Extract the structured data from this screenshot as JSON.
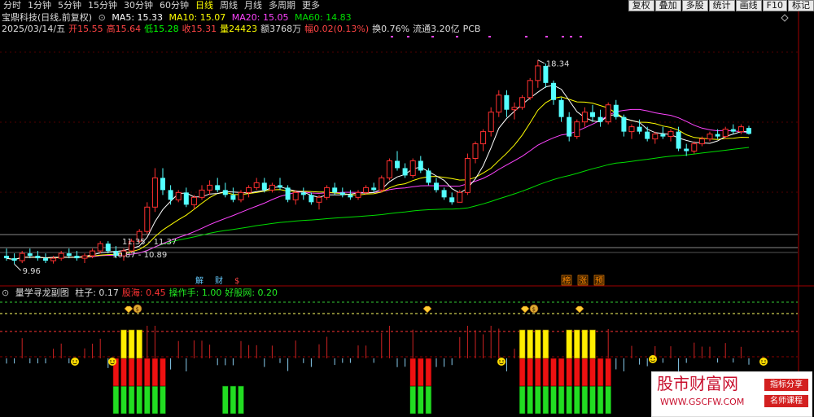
{
  "toolbar": {
    "periods": [
      "分时",
      "1分钟",
      "5分钟",
      "15分钟",
      "30分钟",
      "60分钟",
      "日线",
      "周线",
      "月线",
      "多周期",
      "更多"
    ],
    "active_period": "日线",
    "buttons": [
      "复权",
      "叠加",
      "多股",
      "统计",
      "画线",
      "F10",
      "标记"
    ]
  },
  "stock": {
    "name": "宝鼎科技(日线,前复权)",
    "ma": [
      {
        "label": "MA5: 15.33",
        "color": "#ffffff"
      },
      {
        "label": "MA10: 15.07",
        "color": "#ffff00"
      },
      {
        "label": "MA20: 15.05",
        "color": "#ff44ff"
      },
      {
        "label": "MA60: 14.83",
        "color": "#00dd00"
      }
    ],
    "quote": [
      {
        "text": "2025/03/14/五",
        "color": "#dddddd"
      },
      {
        "text": "开15.55",
        "color": "#ff4444"
      },
      {
        "text": "高15.64",
        "color": "#ff4444"
      },
      {
        "text": "低15.28",
        "color": "#00ff00"
      },
      {
        "text": "收15.31",
        "color": "#ff4444"
      },
      {
        "text": "量24423",
        "color": "#ffff00"
      },
      {
        "text": "额3768万",
        "color": "#dddddd"
      },
      {
        "text": "幅0.02(0.13%)",
        "color": "#ff4444"
      },
      {
        "text": "换0.76%",
        "color": "#dddddd"
      },
      {
        "text": "流通3.20亿",
        "color": "#dddddd"
      },
      {
        "text": "PCB",
        "color": "#dddddd"
      }
    ]
  },
  "annotations": {
    "high": "18.34",
    "low": "9.96",
    "box1": "11.35 - 11.37",
    "box2": "10.87 - 10.89",
    "events_left": [
      {
        "text": "解",
        "color": "#66ccff"
      },
      {
        "text": "财",
        "color": "#66ccff"
      },
      {
        "text": "$",
        "color": "#ff4444"
      }
    ],
    "events_right": [
      {
        "text": "榜",
        "color": "#ff8800"
      },
      {
        "text": "涨",
        "color": "#ff8800"
      },
      {
        "text": "预",
        "color": "#ff8800"
      }
    ]
  },
  "indicator": {
    "name": "量学寻龙副图",
    "values": [
      {
        "text": "柱子: 0.17",
        "color": "#dddddd"
      },
      {
        "text": "股海: 0.45",
        "color": "#ff3333"
      },
      {
        "text": "操作手: 1.00",
        "color": "#22ee22"
      },
      {
        "text": "好股网: 0.20",
        "color": "#22ee22"
      }
    ]
  },
  "colors": {
    "up": "#ff3030",
    "down": "#54ffff",
    "ma5": "#ffffff",
    "ma10": "#ffff00",
    "ma20": "#ff44ff",
    "ma60": "#00dd00",
    "axis": "#a00000"
  },
  "watermark": {
    "title": "股市财富网",
    "url": "WWW.GSCFW.COM",
    "tag1": "指标分享",
    "tag2": "名师课程"
  },
  "chart_data": {
    "type": "candlestick",
    "period": "daily",
    "price_axis_range": [
      9.5,
      19.0
    ],
    "candles_ohlc": [
      [
        10.3,
        10.6,
        10.1,
        10.2
      ],
      [
        10.2,
        10.4,
        9.96,
        10.1
      ],
      [
        10.1,
        10.5,
        10.0,
        10.4
      ],
      [
        10.4,
        10.6,
        10.2,
        10.3
      ],
      [
        10.3,
        10.5,
        10.1,
        10.2
      ],
      [
        10.2,
        10.4,
        10.0,
        10.1
      ],
      [
        10.1,
        10.3,
        9.98,
        10.2
      ],
      [
        10.2,
        10.5,
        10.1,
        10.4
      ],
      [
        10.4,
        10.6,
        10.2,
        10.3
      ],
      [
        10.3,
        10.5,
        10.1,
        10.2
      ],
      [
        10.2,
        10.4,
        10.0,
        10.3
      ],
      [
        10.3,
        10.6,
        10.2,
        10.5
      ],
      [
        10.5,
        10.9,
        10.4,
        10.8
      ],
      [
        10.8,
        10.9,
        10.4,
        10.5
      ],
      [
        10.5,
        10.7,
        10.2,
        10.3
      ],
      [
        10.3,
        10.6,
        10.1,
        10.5
      ],
      [
        10.5,
        11.0,
        10.4,
        10.9
      ],
      [
        10.9,
        11.4,
        10.8,
        11.3
      ],
      [
        11.3,
        12.5,
        11.2,
        12.3
      ],
      [
        12.3,
        13.9,
        12.1,
        13.5
      ],
      [
        13.5,
        13.9,
        12.8,
        13.0
      ],
      [
        13.0,
        13.2,
        12.4,
        12.6
      ],
      [
        12.6,
        13.0,
        12.5,
        12.9
      ],
      [
        12.9,
        13.1,
        12.3,
        12.4
      ],
      [
        12.4,
        12.8,
        12.2,
        12.7
      ],
      [
        12.7,
        13.2,
        12.6,
        13.0
      ],
      [
        13.0,
        13.4,
        12.8,
        13.2
      ],
      [
        13.2,
        13.5,
        12.9,
        13.0
      ],
      [
        13.0,
        13.3,
        12.7,
        12.8
      ],
      [
        12.8,
        13.1,
        12.5,
        12.6
      ],
      [
        12.6,
        13.0,
        12.5,
        12.9
      ],
      [
        12.9,
        13.2,
        12.7,
        13.1
      ],
      [
        13.1,
        13.5,
        13.0,
        13.3
      ],
      [
        13.3,
        13.5,
        12.9,
        13.0
      ],
      [
        13.0,
        13.3,
        12.9,
        13.2
      ],
      [
        13.2,
        13.5,
        13.0,
        13.1
      ],
      [
        13.1,
        13.2,
        12.5,
        12.6
      ],
      [
        12.6,
        13.0,
        12.4,
        12.9
      ],
      [
        12.9,
        13.1,
        12.6,
        12.8
      ],
      [
        12.8,
        12.9,
        12.4,
        12.5
      ],
      [
        12.5,
        12.8,
        12.2,
        12.7
      ],
      [
        12.7,
        13.2,
        12.6,
        13.1
      ],
      [
        13.1,
        13.3,
        12.8,
        12.9
      ],
      [
        12.9,
        13.1,
        12.7,
        12.8
      ],
      [
        12.8,
        13.0,
        12.6,
        12.7
      ],
      [
        12.7,
        13.0,
        12.6,
        12.9
      ],
      [
        12.9,
        13.2,
        12.8,
        13.1
      ],
      [
        13.1,
        13.3,
        12.9,
        13.0
      ],
      [
        13.0,
        13.6,
        12.9,
        13.5
      ],
      [
        13.5,
        14.3,
        13.4,
        14.2
      ],
      [
        14.2,
        14.6,
        13.8,
        13.9
      ],
      [
        13.9,
        14.1,
        13.5,
        13.6
      ],
      [
        13.6,
        14.3,
        13.5,
        14.2
      ],
      [
        14.2,
        14.4,
        13.7,
        13.8
      ],
      [
        13.8,
        13.9,
        13.2,
        13.3
      ],
      [
        13.3,
        13.5,
        12.9,
        13.0
      ],
      [
        13.0,
        13.1,
        12.6,
        12.7
      ],
      [
        12.7,
        12.9,
        12.4,
        12.5
      ],
      [
        12.5,
        13.0,
        12.5,
        12.9
      ],
      [
        12.9,
        14.5,
        12.8,
        14.3
      ],
      [
        14.3,
        15.0,
        14.1,
        14.9
      ],
      [
        14.9,
        15.5,
        14.6,
        15.4
      ],
      [
        15.4,
        16.4,
        15.2,
        16.2
      ],
      [
        16.2,
        17.1,
        16.0,
        16.9
      ],
      [
        16.9,
        17.1,
        16.0,
        16.3
      ],
      [
        16.3,
        16.6,
        15.9,
        16.4
      ],
      [
        16.4,
        16.9,
        16.3,
        16.8
      ],
      [
        16.8,
        17.6,
        16.7,
        17.5
      ],
      [
        17.5,
        18.34,
        17.2,
        18.1
      ],
      [
        18.1,
        18.2,
        17.2,
        17.4
      ],
      [
        17.4,
        17.5,
        16.5,
        16.7
      ],
      [
        16.7,
        16.8,
        15.8,
        16.0
      ],
      [
        16.0,
        16.2,
        15.0,
        15.2
      ],
      [
        15.2,
        15.9,
        15.1,
        15.8
      ],
      [
        15.8,
        16.4,
        15.6,
        16.2
      ],
      [
        16.2,
        16.5,
        15.8,
        16.0
      ],
      [
        16.0,
        16.3,
        15.6,
        15.8
      ],
      [
        15.8,
        16.6,
        15.7,
        16.5
      ],
      [
        16.5,
        16.7,
        15.9,
        16.0
      ],
      [
        16.0,
        16.1,
        15.2,
        15.4
      ],
      [
        15.4,
        15.7,
        15.1,
        15.6
      ],
      [
        15.6,
        15.9,
        15.3,
        15.4
      ],
      [
        15.4,
        15.6,
        15.0,
        15.1
      ],
      [
        15.1,
        15.4,
        14.9,
        15.3
      ],
      [
        15.3,
        15.6,
        15.1,
        15.2
      ],
      [
        15.2,
        15.5,
        15.0,
        15.4
      ],
      [
        15.4,
        15.6,
        14.6,
        14.7
      ],
      [
        14.7,
        14.9,
        14.4,
        14.6
      ],
      [
        14.6,
        15.0,
        14.5,
        14.9
      ],
      [
        14.9,
        15.2,
        14.8,
        15.1
      ],
      [
        15.1,
        15.4,
        15.0,
        15.3
      ],
      [
        15.3,
        15.5,
        15.1,
        15.2
      ],
      [
        15.2,
        15.6,
        15.1,
        15.5
      ],
      [
        15.5,
        15.7,
        15.3,
        15.4
      ],
      [
        15.4,
        15.7,
        15.3,
        15.6
      ],
      [
        15.55,
        15.64,
        15.28,
        15.31
      ]
    ]
  }
}
